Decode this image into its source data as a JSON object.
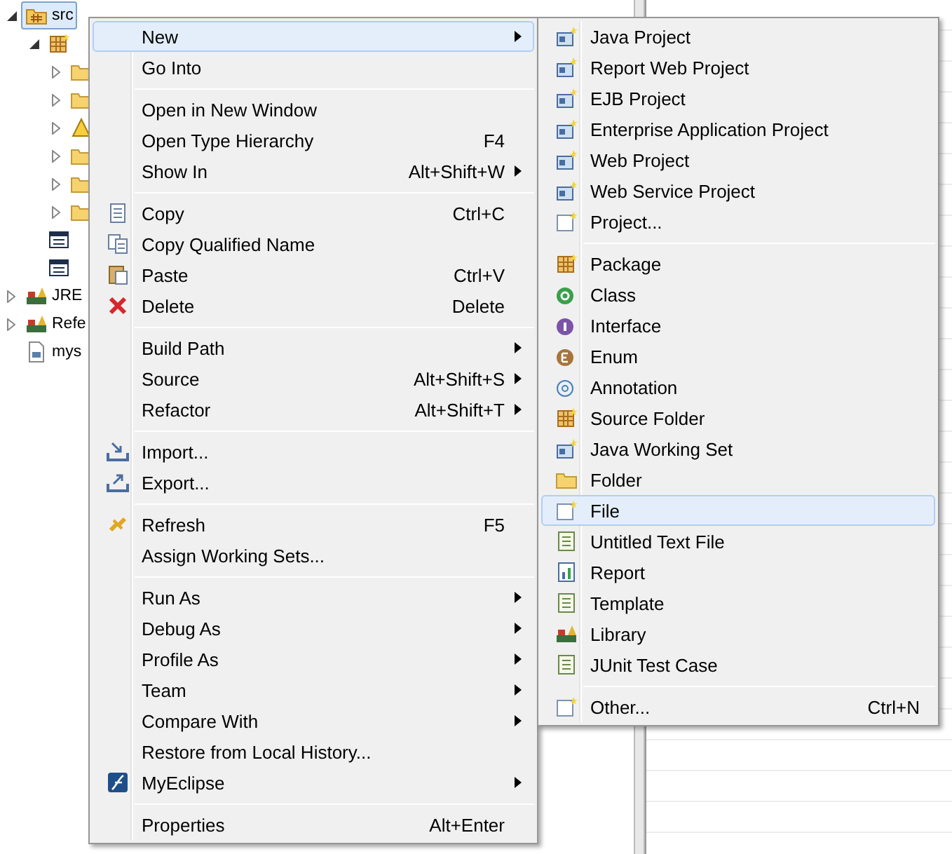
{
  "tree": [
    {
      "label": "src",
      "kind": "source",
      "selected": true,
      "expanded": true,
      "children": [
        {
          "kind": "package",
          "selected": false,
          "expanded": true,
          "children": [
            {
              "kind": "folder",
              "selected": false,
              "expanded": false
            },
            {
              "kind": "folder",
              "selected": false,
              "expanded": false
            },
            {
              "kind": "warning",
              "selected": false,
              "expanded": false
            },
            {
              "kind": "folder",
              "selected": false,
              "expanded": false
            },
            {
              "kind": "folder",
              "selected": false,
              "expanded": false
            },
            {
              "kind": "folder",
              "selected": false,
              "expanded": false
            }
          ]
        },
        {
          "kind": "table",
          "selected": false
        },
        {
          "kind": "table",
          "selected": false
        }
      ]
    },
    {
      "label": "JRE",
      "kind": "library",
      "selected": false,
      "expanded": false
    },
    {
      "label": "Refe",
      "kind": "library",
      "selected": false,
      "expanded": false
    },
    {
      "label": "mys",
      "kind": "file",
      "selected": false
    }
  ],
  "context_menu": [
    {
      "kind": "plain",
      "label": "New",
      "selected": true,
      "submenu": true
    },
    {
      "kind": "plain",
      "label": "Go Into",
      "selected": false
    },
    {
      "kind": "separator"
    },
    {
      "kind": "plain",
      "label": "Open in New Window",
      "selected": false
    },
    {
      "kind": "plain",
      "label": "Open Type Hierarchy",
      "shortcut": "F4",
      "selected": false
    },
    {
      "kind": "plain",
      "label": "Show In",
      "shortcut": "Alt+Shift+W",
      "selected": false,
      "submenu": true
    },
    {
      "kind": "separator"
    },
    {
      "kind": "copy",
      "label": "Copy",
      "shortcut": "Ctrl+C",
      "selected": false
    },
    {
      "kind": "copy2",
      "label": "Copy Qualified Name",
      "selected": false
    },
    {
      "kind": "paste",
      "label": "Paste",
      "shortcut": "Ctrl+V",
      "selected": false
    },
    {
      "kind": "delete",
      "label": "Delete",
      "shortcut": "Delete",
      "selected": false
    },
    {
      "kind": "separator"
    },
    {
      "kind": "plain",
      "label": "Build Path",
      "selected": false,
      "submenu": true
    },
    {
      "kind": "plain",
      "label": "Source",
      "shortcut": "Alt+Shift+S",
      "selected": false,
      "submenu": true
    },
    {
      "kind": "plain",
      "label": "Refactor",
      "shortcut": "Alt+Shift+T",
      "selected": false,
      "submenu": true
    },
    {
      "kind": "separator"
    },
    {
      "kind": "import",
      "label": "Import...",
      "selected": false
    },
    {
      "kind": "export",
      "label": "Export...",
      "selected": false
    },
    {
      "kind": "separator"
    },
    {
      "kind": "refresh",
      "label": "Refresh",
      "shortcut": "F5",
      "selected": false
    },
    {
      "kind": "plain",
      "label": "Assign Working Sets...",
      "selected": false
    },
    {
      "kind": "separator"
    },
    {
      "kind": "plain",
      "label": "Run As",
      "selected": false,
      "submenu": true
    },
    {
      "kind": "plain",
      "label": "Debug As",
      "selected": false,
      "submenu": true
    },
    {
      "kind": "plain",
      "label": "Profile As",
      "selected": false,
      "submenu": true
    },
    {
      "kind": "plain",
      "label": "Team",
      "selected": false,
      "submenu": true
    },
    {
      "kind": "plain",
      "label": "Compare With",
      "selected": false,
      "submenu": true
    },
    {
      "kind": "plain",
      "label": "Restore from Local History...",
      "selected": false
    },
    {
      "kind": "myeclipse",
      "label": "MyEclipse",
      "selected": false,
      "submenu": true
    },
    {
      "kind": "separator"
    },
    {
      "kind": "plain",
      "label": "Properties",
      "shortcut": "Alt+Enter",
      "selected": false
    }
  ],
  "new_submenu": [
    {
      "kind": "project",
      "label": "Java Project",
      "selected": false
    },
    {
      "kind": "project",
      "label": "Report Web Project",
      "selected": false
    },
    {
      "kind": "project",
      "label": "EJB Project",
      "selected": false
    },
    {
      "kind": "project",
      "label": "Enterprise Application Project",
      "selected": false
    },
    {
      "kind": "project",
      "label": "Web Project",
      "selected": false
    },
    {
      "kind": "project",
      "label": "Web Service Project",
      "selected": false
    },
    {
      "kind": "newfile",
      "label": "Project...",
      "selected": false
    },
    {
      "kind": "separator"
    },
    {
      "kind": "package",
      "label": "Package",
      "selected": false
    },
    {
      "kind": "class",
      "label": "Class",
      "selected": false
    },
    {
      "kind": "interface",
      "label": "Interface",
      "selected": false
    },
    {
      "kind": "enum",
      "label": "Enum",
      "selected": false
    },
    {
      "kind": "annotation",
      "label": "Annotation",
      "selected": false
    },
    {
      "kind": "package",
      "label": "Source Folder",
      "selected": false
    },
    {
      "kind": "project",
      "label": "Java Working Set",
      "selected": false
    },
    {
      "kind": "folder",
      "label": "Folder",
      "selected": false
    },
    {
      "kind": "newfile",
      "label": "File",
      "selected": true
    },
    {
      "kind": "text",
      "label": "Untitled Text File",
      "selected": false
    },
    {
      "kind": "report",
      "label": "Report",
      "selected": false
    },
    {
      "kind": "text",
      "label": "Template",
      "selected": false
    },
    {
      "kind": "library",
      "label": "Library",
      "selected": false
    },
    {
      "kind": "text",
      "label": "JUnit Test Case",
      "selected": false
    },
    {
      "kind": "separator"
    },
    {
      "kind": "newfile",
      "label": "Other...",
      "shortcut": "Ctrl+N",
      "selected": false
    }
  ]
}
